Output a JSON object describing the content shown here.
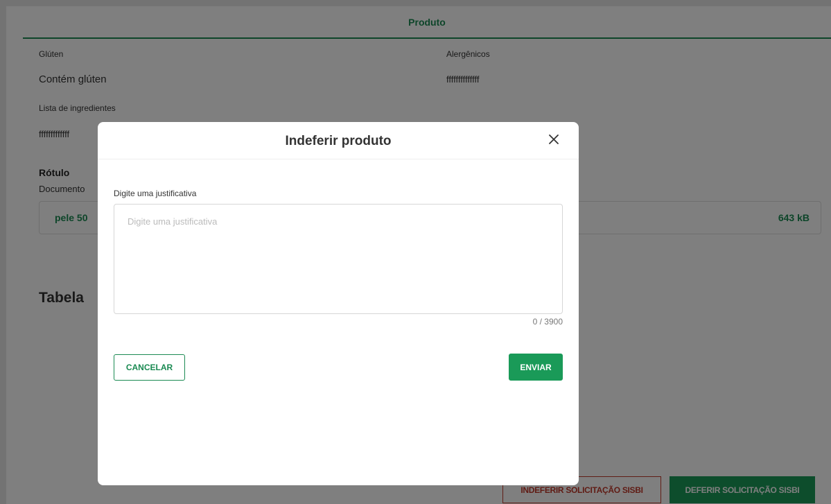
{
  "page": {
    "section_title": "Produto",
    "gluten_label": "Glúten",
    "gluten_value": "Contém glúten",
    "alergenicos_label": "Alergênicos",
    "alergenicos_value": "ffffffffffffff",
    "ingredientes_label": "Lista de ingredientes",
    "ingredientes_value": "fffffffffffff",
    "rotulo_title": "Rótulo",
    "documento_label": "Documento",
    "file_name": "pele 50",
    "file_size": "643 kB",
    "tabela_title": "Tabela",
    "indeferir_sisbi_label": "INDEFERIR SOLICITAÇÃO SISBI",
    "deferir_sisbi_label": "DEFERIR SOLICITAÇÃO SISBI"
  },
  "modal": {
    "title": "Indeferir produto",
    "field_label": "Digite uma justificativa",
    "placeholder": "Digite uma justificativa",
    "value": "",
    "counter": "0 / 3900",
    "cancel_label": "CANCELAR",
    "send_label": "ENVIAR",
    "close_icon": "close-icon"
  },
  "colors": {
    "primary": "#1a8a52",
    "danger": "#c0392b"
  }
}
